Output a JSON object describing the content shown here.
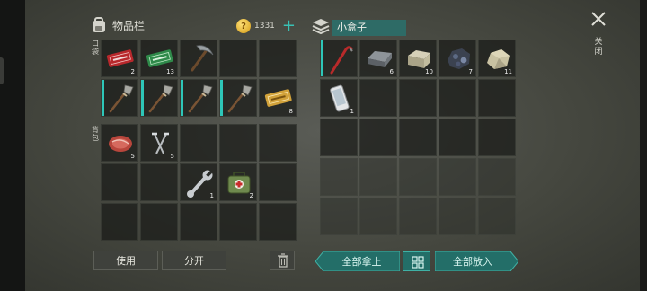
{
  "inventory": {
    "title": "物品栏",
    "currency": "1331",
    "pocket_label": "口袋",
    "backpack_label": "背包",
    "pocket_slots": [
      {
        "icon": "red-ticket-icon",
        "count": "2"
      },
      {
        "icon": "green-ticket-icon",
        "count": "13"
      },
      {
        "icon": "pickaxe-icon",
        "count": ""
      },
      {
        "icon": "",
        "count": ""
      },
      {
        "icon": "",
        "count": ""
      },
      {
        "icon": "stone-spear-icon",
        "count": ""
      },
      {
        "icon": "stone-spear-icon",
        "count": ""
      },
      {
        "icon": "stone-spear-icon",
        "count": ""
      },
      {
        "icon": "stone-spear-icon",
        "count": ""
      },
      {
        "icon": "gold-ticket-icon",
        "count": "8"
      }
    ],
    "backpack_slots": [
      {
        "icon": "raw-meat-icon",
        "count": "5"
      },
      {
        "icon": "nails-icon",
        "count": "5"
      },
      {
        "icon": "",
        "count": ""
      },
      {
        "icon": "",
        "count": ""
      },
      {
        "icon": "",
        "count": ""
      },
      {
        "icon": "",
        "count": ""
      },
      {
        "icon": "",
        "count": ""
      },
      {
        "icon": "wrench-icon",
        "count": "1"
      },
      {
        "icon": "first-aid-kit-icon",
        "count": "2"
      },
      {
        "icon": "",
        "count": ""
      },
      {
        "icon": "",
        "count": ""
      },
      {
        "icon": "",
        "count": ""
      },
      {
        "icon": "",
        "count": ""
      },
      {
        "icon": "",
        "count": ""
      },
      {
        "icon": "",
        "count": ""
      }
    ],
    "use_label": "使用",
    "split_label": "分开"
  },
  "container": {
    "title": "小盒子",
    "slots": [
      {
        "icon": "crowbar-icon",
        "count": ""
      },
      {
        "icon": "iron-bar-icon",
        "count": "6"
      },
      {
        "icon": "stone-block-icon",
        "count": "10"
      },
      {
        "icon": "coal-ore-icon",
        "count": "7"
      },
      {
        "icon": "stone-icon",
        "count": "11"
      },
      {
        "icon": "phone-icon",
        "count": "1"
      }
    ],
    "take_all_label": "全部拿上",
    "put_all_label": "全部放入"
  },
  "close_label": "关闭",
  "colors": {
    "accent": "#2ec6b8",
    "button_teal": "#236e68",
    "coin": "#e0a818"
  }
}
